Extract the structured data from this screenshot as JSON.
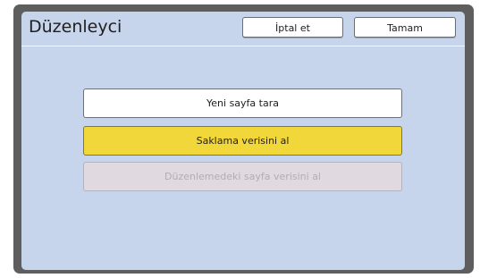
{
  "header": {
    "title": "Düzenleyci",
    "cancel_label": "İptal et",
    "ok_label": "Tamam"
  },
  "options": [
    {
      "label": "Yeni sayfa tara",
      "state": "normal"
    },
    {
      "label": "Saklama verisini al",
      "state": "selected"
    },
    {
      "label": "Düzenlemedeki sayfa verisini al",
      "state": "disabled"
    }
  ],
  "colors": {
    "panel_bg": "#c6d4ec",
    "selected_bg": "#f1d73a",
    "disabled_bg": "#e0d9df",
    "frame": "#5e5e5e"
  }
}
